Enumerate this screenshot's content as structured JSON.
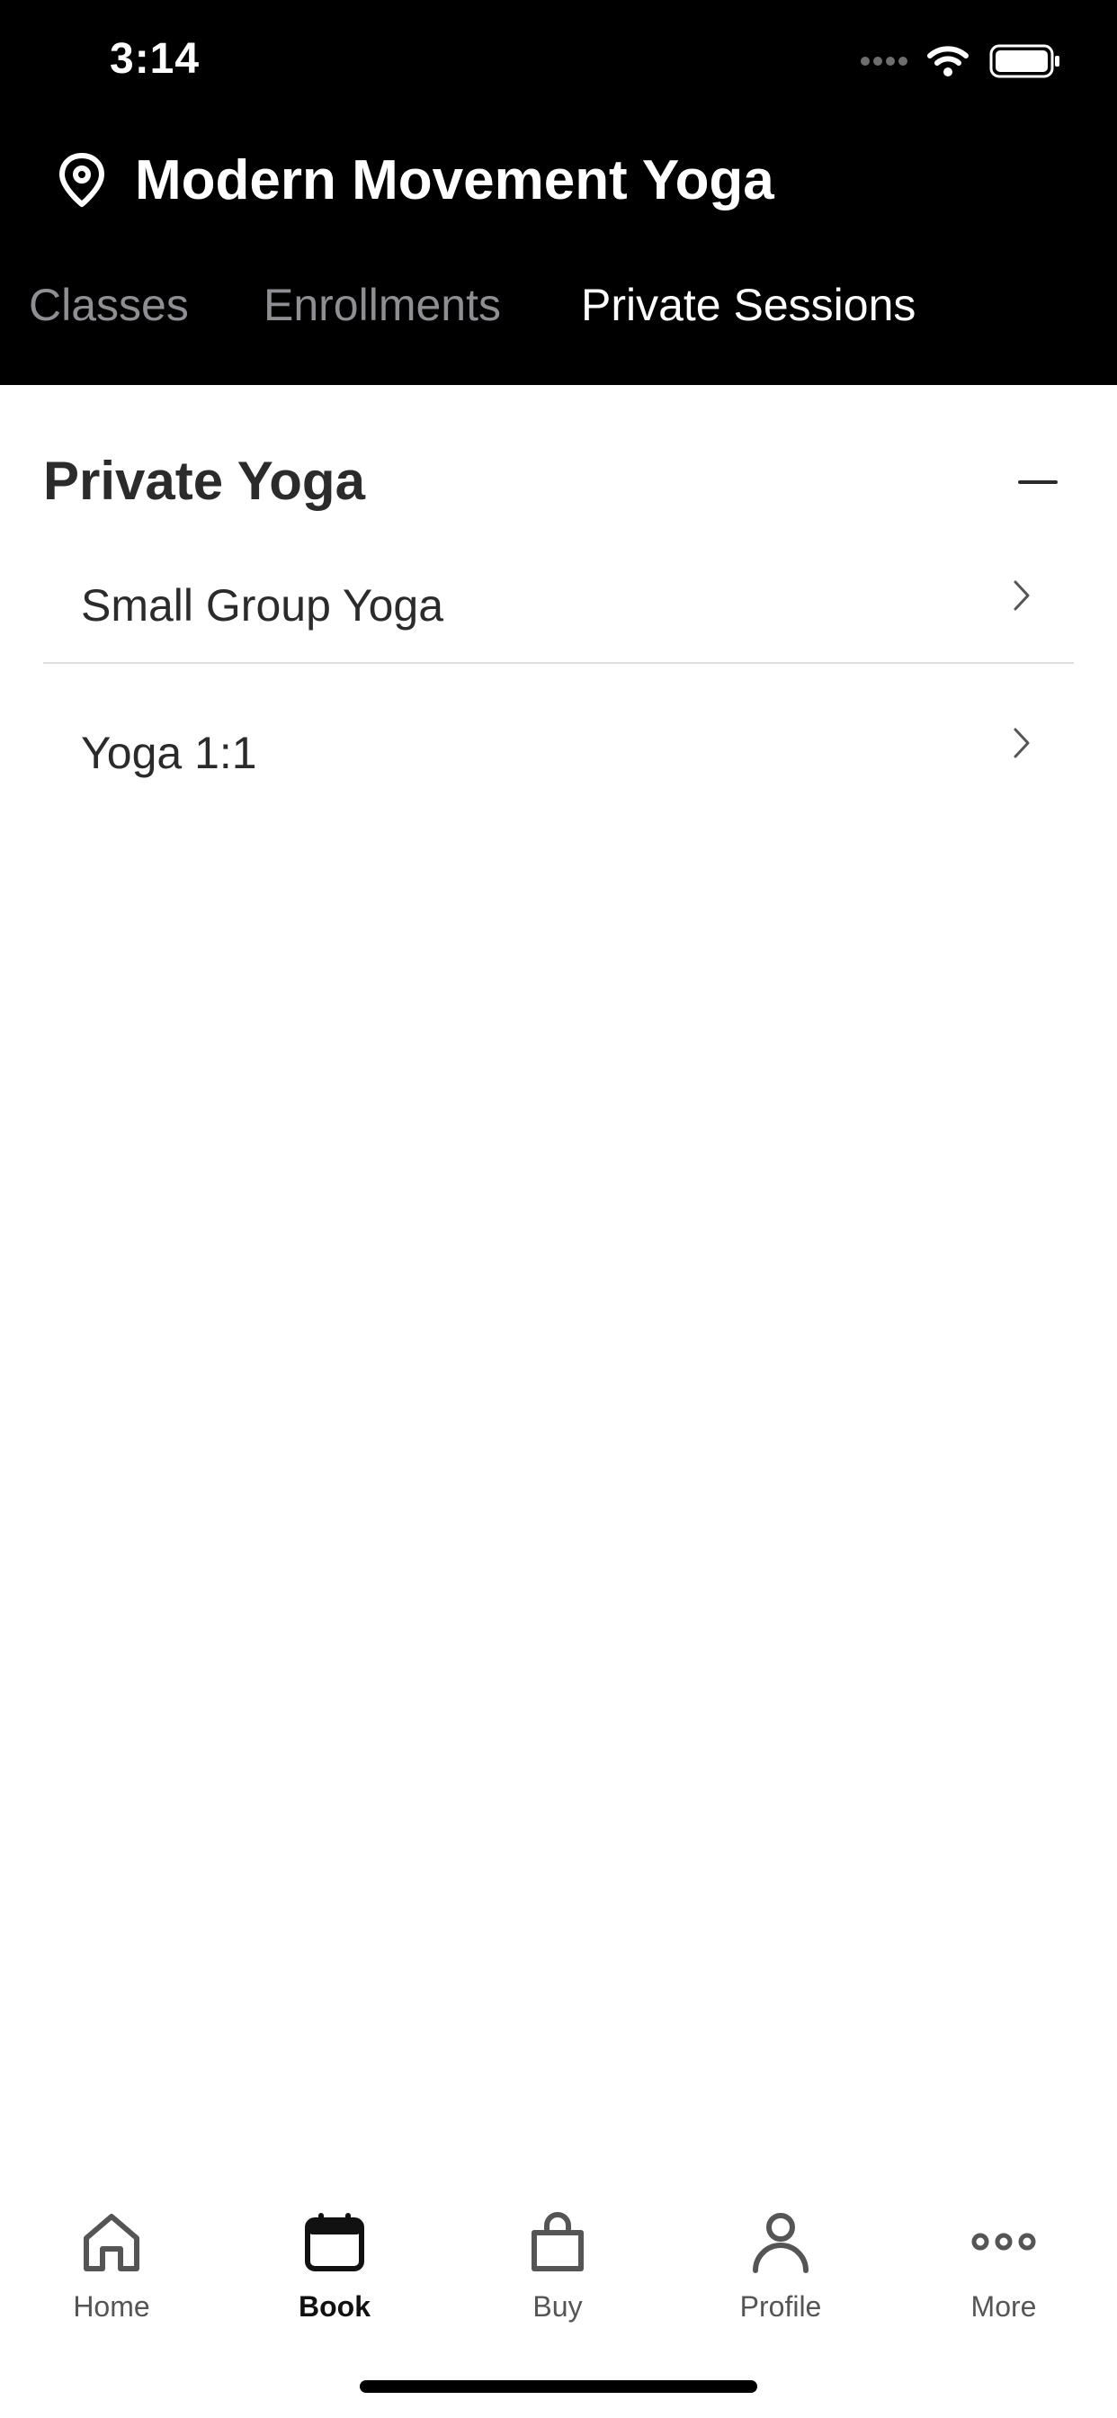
{
  "status_bar": {
    "time": "3:14"
  },
  "header": {
    "studio_name": "Modern Movement Yoga"
  },
  "tabs": [
    {
      "label": "Classes",
      "active": false
    },
    {
      "label": "Enrollments",
      "active": false
    },
    {
      "label": "Private Sessions",
      "active": true
    }
  ],
  "section": {
    "title": "Private Yoga",
    "items": [
      {
        "label": "Small Group Yoga"
      },
      {
        "label": "Yoga 1:1"
      }
    ]
  },
  "tab_bar": {
    "items": [
      {
        "label": "Home",
        "icon": "home-icon",
        "active": false
      },
      {
        "label": "Book",
        "icon": "calendar-icon",
        "active": true
      },
      {
        "label": "Buy",
        "icon": "shopping-bag-icon",
        "active": false
      },
      {
        "label": "Profile",
        "icon": "person-icon",
        "active": false
      },
      {
        "label": "More",
        "icon": "more-dots-icon",
        "active": false
      }
    ]
  },
  "colors": {
    "header_background": "#000000",
    "inactive_tab": "#8e8e93",
    "active_tab": "#ffffff",
    "text": "#2b2b2b"
  }
}
